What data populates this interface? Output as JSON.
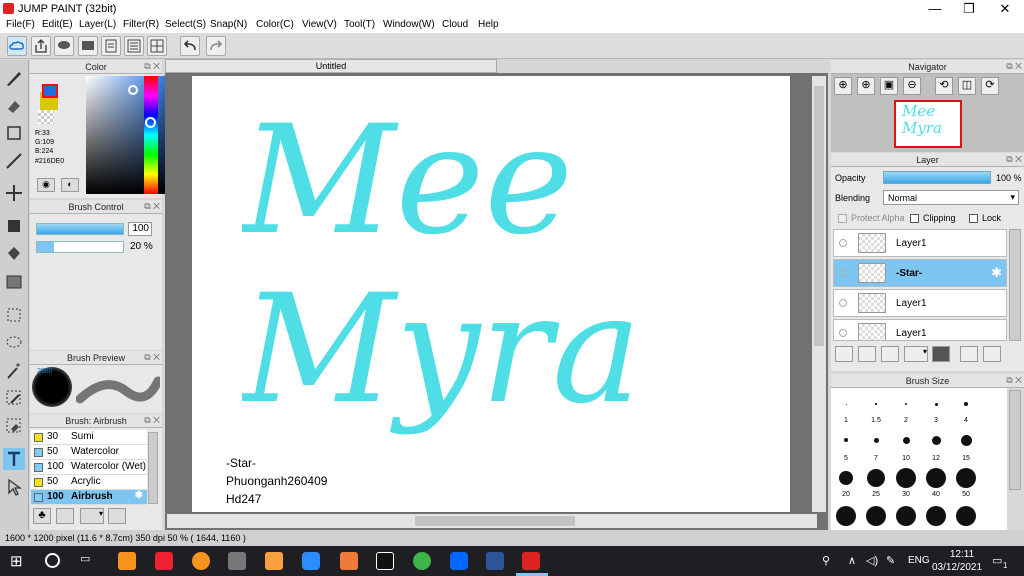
{
  "window": {
    "title": "JUMP PAINT (32bit)",
    "min": "—",
    "max": "❐",
    "close": "✕"
  },
  "menu": [
    "File(F)",
    "Edit(E)",
    "Layer(L)",
    "Filter(R)",
    "Select(S)",
    "Snap(N)",
    "Color(C)",
    "View(V)",
    "Tool(T)",
    "Window(W)",
    "Cloud",
    "Help"
  ],
  "color_panel": {
    "title": "Color",
    "r": "R:33",
    "g": "G:109",
    "b": "B:224",
    "hex": "#216DE0"
  },
  "brush_control": {
    "title": "Brush Control",
    "size": "100",
    "density": "20 %"
  },
  "brush_preview": {
    "title": "Brush Preview",
    "size_label": "2560"
  },
  "brush_list": {
    "title": "Brush: Airbrush",
    "items": [
      {
        "size": "30",
        "name": "Sumi",
        "color": "#f4e21b"
      },
      {
        "size": "50",
        "name": "Watercolor",
        "color": "#7ed0f2"
      },
      {
        "size": "100",
        "name": "Watercolor (Wet)",
        "color": "#7ed0f2"
      },
      {
        "size": "50",
        "name": "Acrylic",
        "color": "#f4e21b"
      },
      {
        "size": "100",
        "name": "Airbrush",
        "color": "#7ed0f2"
      }
    ]
  },
  "document": {
    "tab": "Untitled",
    "line1": "Mee",
    "line2": "Myra",
    "credit1": "-Star-",
    "credit2": "Phuonganh260409",
    "credit3": "Hd247",
    "lettering_color": "#4fdde6"
  },
  "navigator": {
    "title": "Navigator",
    "thumb_text1": "Mee",
    "thumb_text2": "Myra"
  },
  "layer_panel": {
    "title": "Layer",
    "opacity_label": "Opacity",
    "opacity_value": "100 %",
    "blending_label": "Blending",
    "blending_value": "Normal",
    "protect_alpha": "Protect Alpha",
    "clipping": "Clipping",
    "lock": "Lock",
    "layers": [
      {
        "name": "Layer1",
        "selected": false
      },
      {
        "name": "-Star-",
        "selected": true
      },
      {
        "name": "Layer1",
        "selected": false
      },
      {
        "name": "Layer1",
        "selected": false
      }
    ]
  },
  "brush_size": {
    "title": "Brush Size",
    "rows": [
      [
        "1",
        "1.5",
        "2",
        "3",
        "4"
      ],
      [
        "5",
        "7",
        "10",
        "12",
        "15"
      ],
      [
        "20",
        "25",
        "30",
        "40",
        "50"
      ]
    ]
  },
  "status": {
    "text": "1600 * 1200 pixel   (11.6 * 8.7cm)   350 dpi   50 %   ( 1644, 1160 )"
  },
  "taskbar": {
    "lang": "ENG",
    "time": "12:11",
    "date": "03/12/2021",
    "notif": "1"
  }
}
